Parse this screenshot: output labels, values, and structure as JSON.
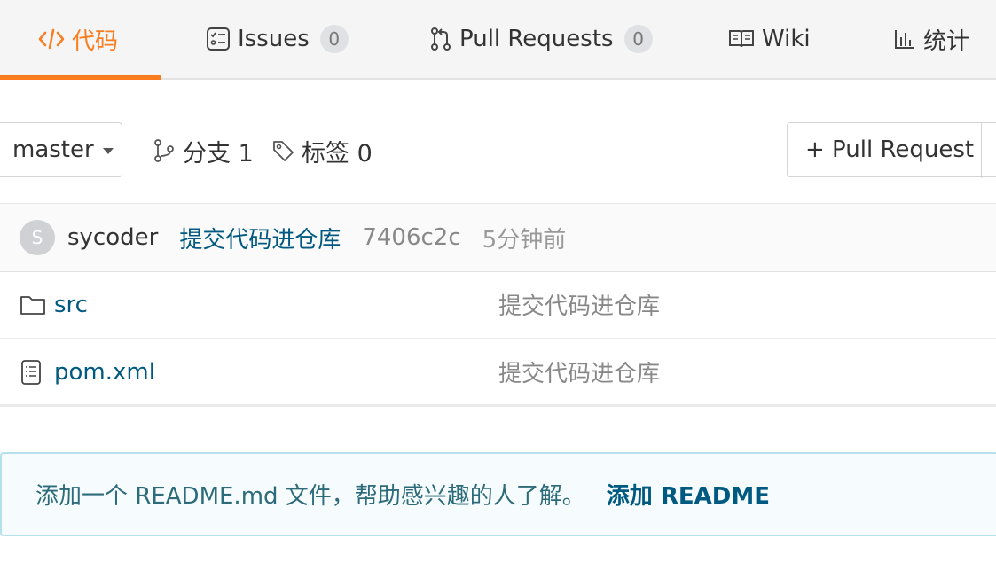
{
  "tabs": [
    {
      "label": "代码",
      "icon": "code-icon",
      "active": true
    },
    {
      "label": "Issues",
      "icon": "issues-icon",
      "count": "0"
    },
    {
      "label": "Pull Requests",
      "icon": "pull-request-icon",
      "count": "0"
    },
    {
      "label": "Wiki",
      "icon": "book-icon"
    },
    {
      "label": "统计",
      "icon": "bar-chart-icon"
    }
  ],
  "toolbar": {
    "branch": "master",
    "branches": "分支 1",
    "tags": "标签 0",
    "pull_request_button": "+ Pull Request"
  },
  "last_commit": {
    "avatar_letter": "S",
    "author": "sycoder",
    "message": "提交代码进仓库",
    "sha": "7406c2c",
    "time": "5分钟前"
  },
  "files": [
    {
      "name": "src",
      "type": "folder",
      "icon": "folder-icon",
      "commit_message": "提交代码进仓库"
    },
    {
      "name": "pom.xml",
      "type": "file",
      "icon": "file-text-icon",
      "commit_message": "提交代码进仓库"
    }
  ],
  "readme_notice": {
    "text": "添加一个 README.md 文件，帮助感兴趣的人了解。",
    "link": "添加 README"
  },
  "colors": {
    "accent": "#fa7c1e",
    "link": "#005980",
    "muted": "#888888",
    "notice_bg": "#f6fcfd",
    "notice_border": "#b5e1ea"
  }
}
